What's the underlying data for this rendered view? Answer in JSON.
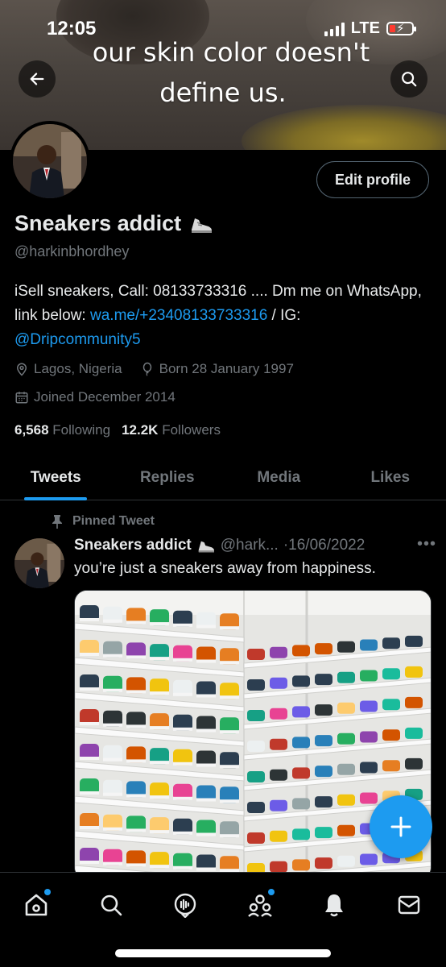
{
  "status_bar": {
    "time": "12:05",
    "network": "LTE"
  },
  "banner": {
    "line1": "our skin color doesn't",
    "line2": "define us."
  },
  "profile": {
    "name": "Sneakers addict",
    "handle": "@harkinbhordhey",
    "edit_button": "Edit profile",
    "bio_text_1": "iSell sneakers, Call: 08133733316 .... Dm me on WhatsApp, link below: ",
    "bio_link_1": "wa.me/+23408133733316",
    "bio_text_2": " / IG: ",
    "bio_link_2": "@Dripcommunity5",
    "location": "Lagos, Nigeria",
    "born": "Born 28 January 1997",
    "joined": "Joined December 2014",
    "following_count": "6,568",
    "following_label": "Following",
    "followers_count": "12.2K",
    "followers_label": "Followers"
  },
  "tabs": [
    {
      "label": "Tweets",
      "active": true
    },
    {
      "label": "Replies",
      "active": false
    },
    {
      "label": "Media",
      "active": false
    },
    {
      "label": "Likes",
      "active": false
    }
  ],
  "pinned_tweet": {
    "pinned_label": "Pinned Tweet",
    "author": "Sneakers addict",
    "handle": "@hark...",
    "date": "·16/06/2022",
    "more": "•••",
    "text": "you’re just a sneakers away from happiness."
  },
  "colors": {
    "accent": "#1d9bf0",
    "background": "#000000",
    "text": "#e7e9ea",
    "muted": "#71767b"
  },
  "icons": {
    "back": "arrow-left-icon",
    "search": "search-icon",
    "shoe": "sneaker-emoji-icon",
    "location": "location-pin-icon",
    "born": "balloon-icon",
    "joined": "calendar-icon",
    "pin": "pin-icon",
    "compose": "plus-icon",
    "nav": [
      "home-icon",
      "search-icon",
      "spaces-icon",
      "communities-icon",
      "notifications-icon",
      "messages-icon"
    ]
  }
}
